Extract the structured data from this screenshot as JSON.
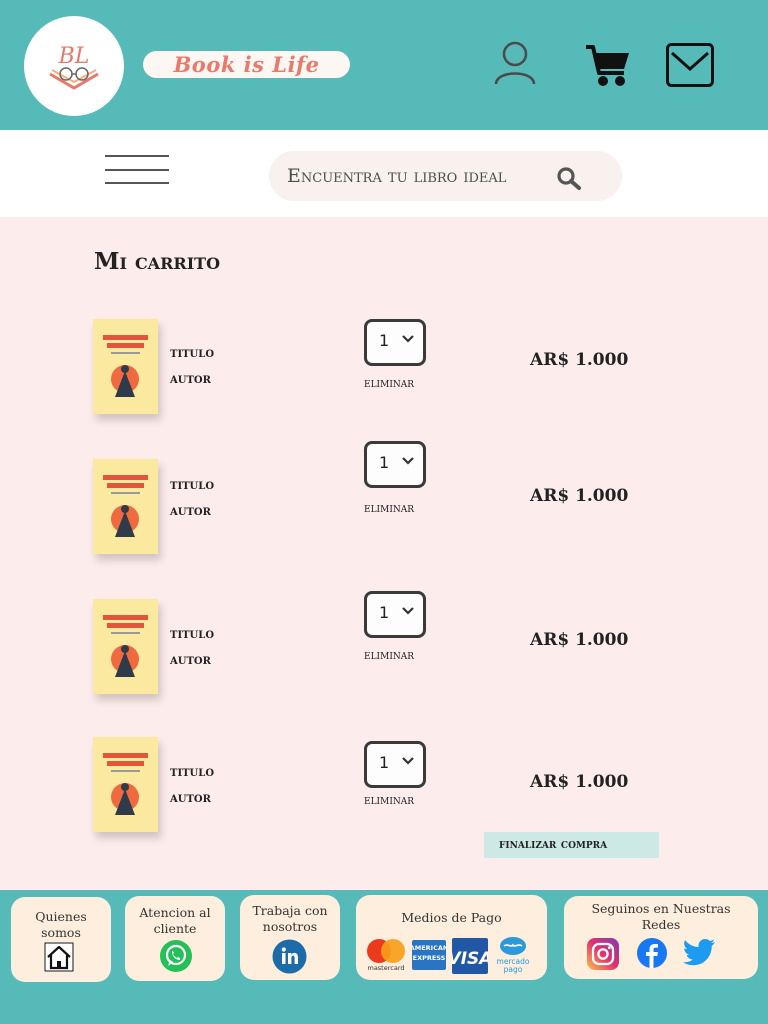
{
  "header": {
    "logo_initials": "BL",
    "brand_name": "Book is Life",
    "icons": [
      "user-icon",
      "cart-icon",
      "mail-icon"
    ],
    "accent_color": "#56bab9"
  },
  "nav": {
    "search_placeholder": "Encuentra tu libro ideal",
    "icons": [
      "menu-icon",
      "search-icon"
    ]
  },
  "cart": {
    "title": "Mi carrito",
    "items": [
      {
        "title": "titulo",
        "author": "autor",
        "quantity": "1",
        "remove_label": "eliminar",
        "price": "AR$ 1.000"
      },
      {
        "title": "titulo",
        "author": "autor",
        "quantity": "1",
        "remove_label": "eliminar",
        "price": "AR$ 1.000"
      },
      {
        "title": "titulo",
        "author": "autor",
        "quantity": "1",
        "remove_label": "eliminar",
        "price": "AR$ 1.000"
      },
      {
        "title": "titulo",
        "author": "autor",
        "quantity": "1",
        "remove_label": "eliminar",
        "price": "AR$ 1.000"
      }
    ],
    "checkout_label": "finalizar compra"
  },
  "footer": {
    "about": {
      "label": "Quienes somos",
      "icon": "home-icon"
    },
    "support": {
      "label": "Atencion al cliente",
      "icon": "whatsapp-icon"
    },
    "jobs": {
      "label": "Trabaja con nosotros",
      "icon": "linkedin-icon"
    },
    "payments": {
      "label": "Medios de Pago",
      "methods": [
        "mastercard",
        "american express",
        "VISA",
        "mercado pago"
      ]
    },
    "social": {
      "label": "Seguinos en Nuestras Redes",
      "icons": [
        "instagram-icon",
        "facebook-icon",
        "twitter-icon"
      ]
    }
  }
}
